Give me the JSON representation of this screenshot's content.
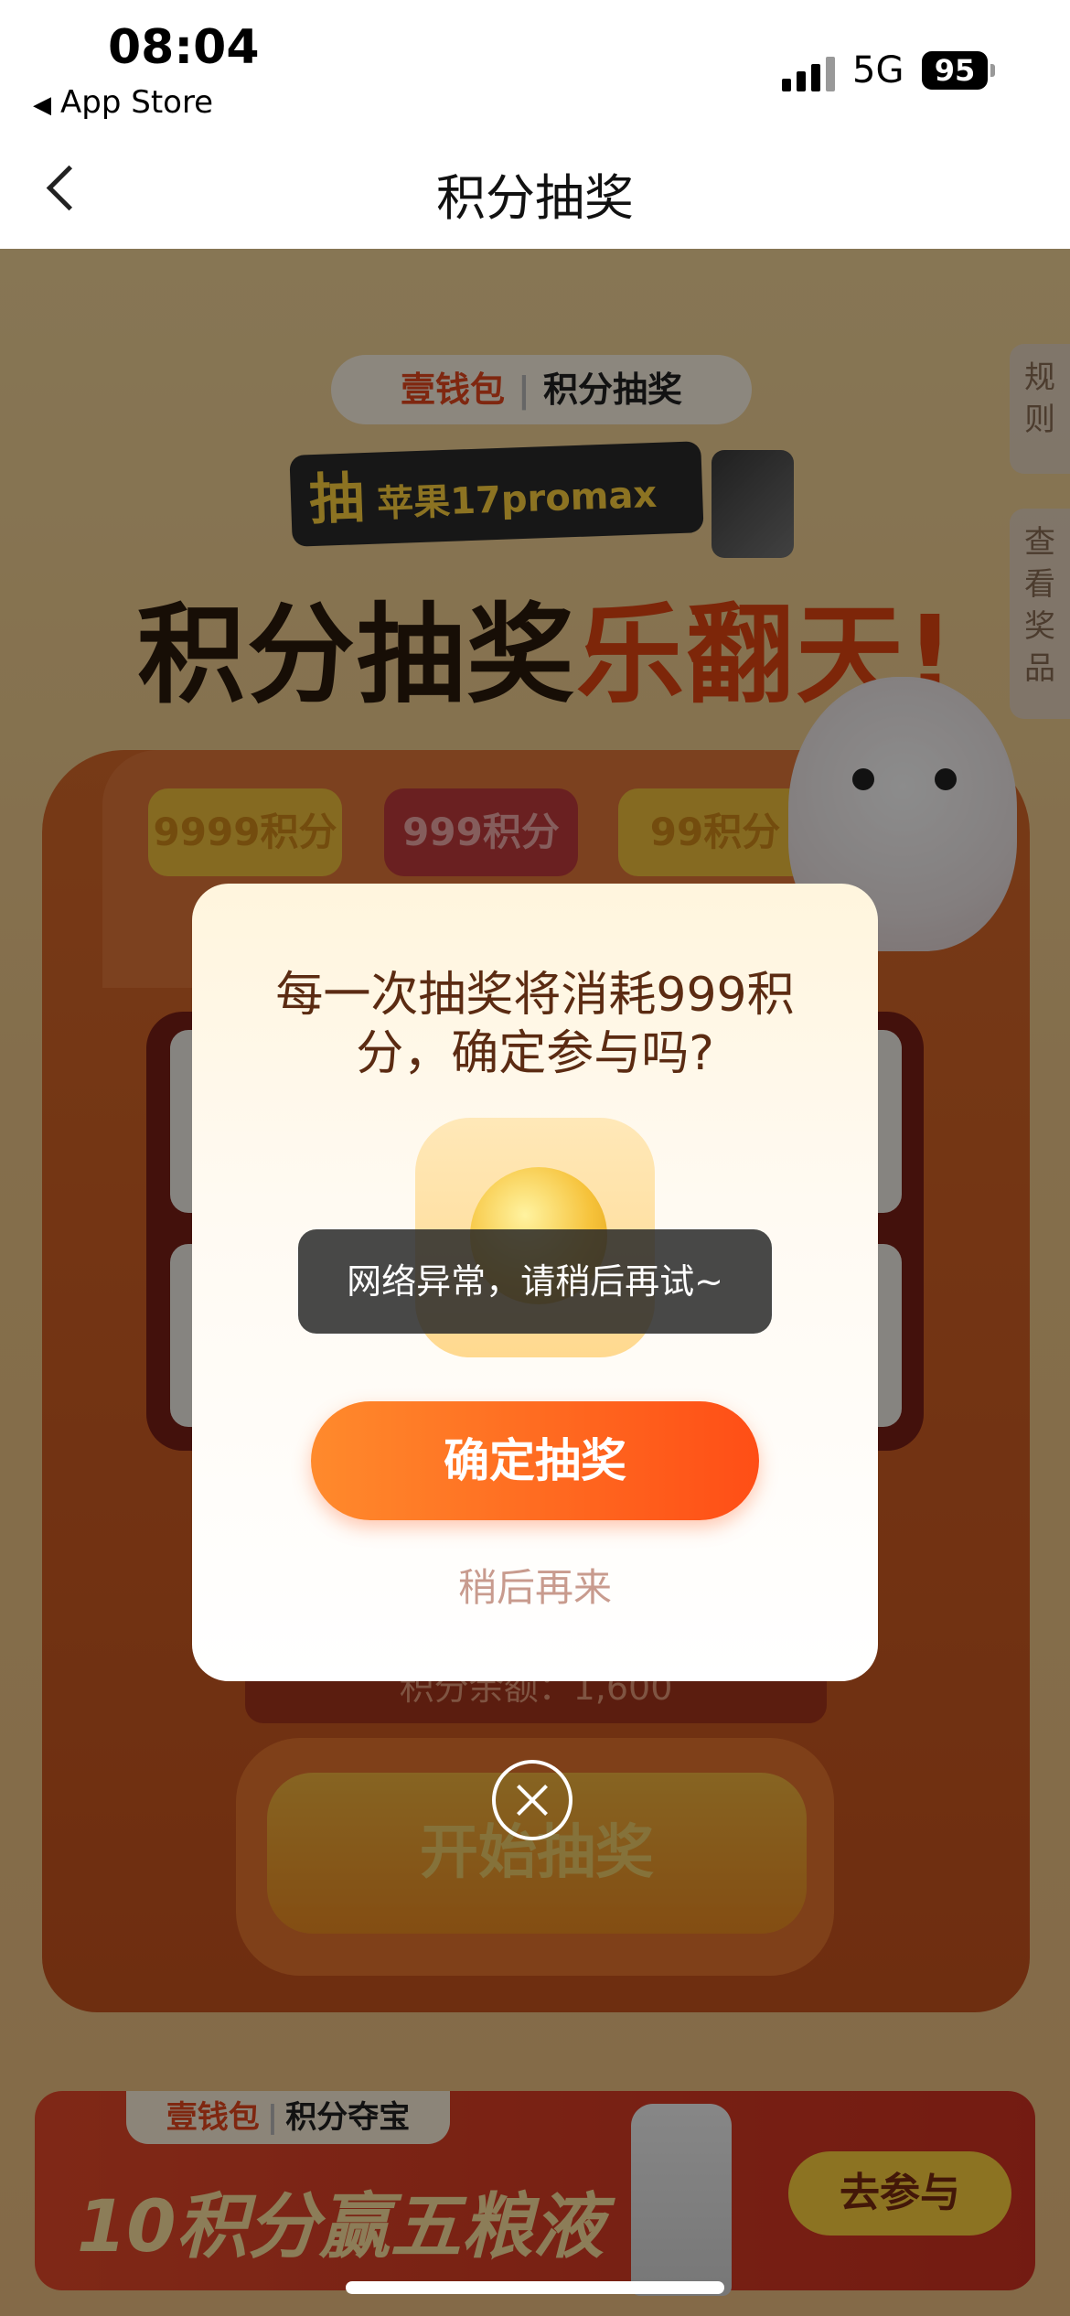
{
  "status_bar": {
    "time": "08:04",
    "back_app": "App Store",
    "network": "5G",
    "battery": "95"
  },
  "nav": {
    "title": "积分抽奖"
  },
  "background": {
    "brand_name": "壹钱包",
    "brand_section": "积分抽奖",
    "promo_prefix": "抽",
    "promo_text": "苹果17promax",
    "headline_black": "积分抽奖",
    "headline_red": "乐翻天!",
    "side_tab_rules": "规则",
    "side_tab_prizes": "查看奖品",
    "chips": [
      "9999积分",
      "999积分",
      "99积分"
    ],
    "balance_text": "积分余额：1,600",
    "start_button": "开始抽奖",
    "banner": {
      "brand_name": "壹钱包",
      "brand_section": "积分夺宝",
      "text": "10积分赢五粮液",
      "button": "去参与"
    }
  },
  "dialog": {
    "title": "每一次抽奖将消耗999积分，确定参与吗?",
    "confirm_button": "确定抽奖",
    "later_link": "稍后再来"
  },
  "toast": {
    "message": "网络异常，请稍后再试~"
  }
}
